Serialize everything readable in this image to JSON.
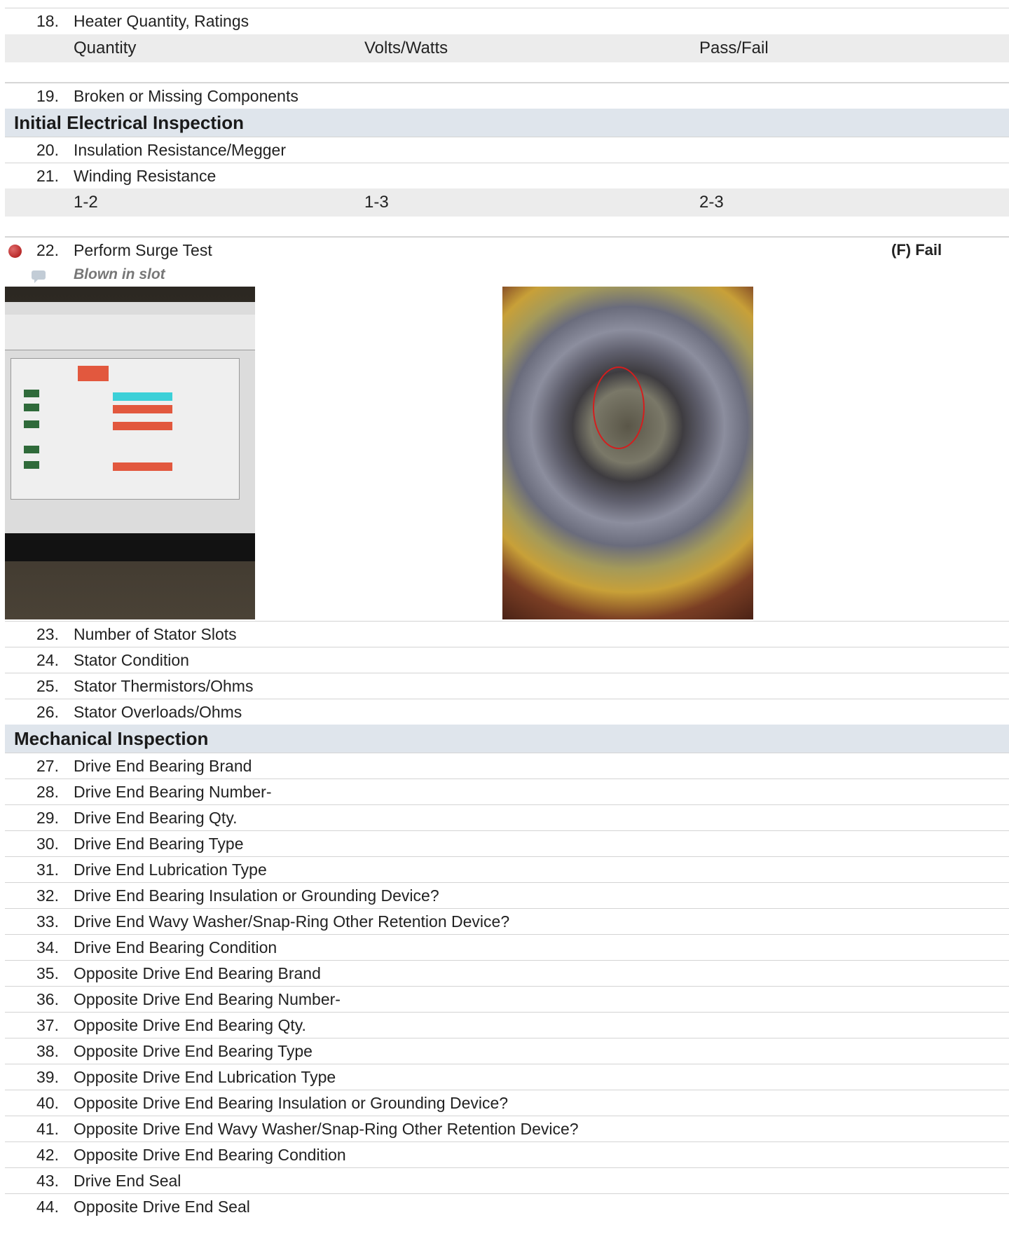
{
  "items_top": [
    {
      "num": "18.",
      "label": "Heater Quantity, Ratings"
    }
  ],
  "heater_columns": [
    "Quantity",
    "Volts/Watts",
    "Pass/Fail"
  ],
  "item_19": {
    "num": "19.",
    "label": "Broken or Missing Components"
  },
  "sections": {
    "initial_electrical": "Initial Electrical Inspection",
    "mechanical": "Mechanical Inspection"
  },
  "electrical_items": [
    {
      "num": "20.",
      "label": "Insulation Resistance/Megger"
    },
    {
      "num": "21.",
      "label": "Winding Resistance"
    }
  ],
  "winding_columns": [
    "1-2",
    "1-3",
    "2-3"
  ],
  "surge_test": {
    "num": "22.",
    "label": "Perform Surge Test",
    "result": "(F) Fail",
    "status_color": "#c0392b",
    "comment": "Blown in slot"
  },
  "stator_items": [
    {
      "num": "23.",
      "label": "Number of Stator Slots"
    },
    {
      "num": "24.",
      "label": "Stator Condition"
    },
    {
      "num": "25.",
      "label": "Stator Thermistors/Ohms"
    },
    {
      "num": "26.",
      "label": "Stator Overloads/Ohms"
    }
  ],
  "mechanical_items": [
    {
      "num": "27.",
      "label": "Drive End Bearing Brand"
    },
    {
      "num": "28.",
      "label": "Drive End Bearing Number-"
    },
    {
      "num": "29.",
      "label": "Drive End Bearing Qty."
    },
    {
      "num": "30.",
      "label": "Drive End Bearing Type"
    },
    {
      "num": "31.",
      "label": "Drive End Lubrication Type"
    },
    {
      "num": "32.",
      "label": "Drive End Bearing Insulation or Grounding Device?"
    },
    {
      "num": "33.",
      "label": "Drive End Wavy Washer/Snap-Ring Other Retention Device?"
    },
    {
      "num": "34.",
      "label": "Drive End Bearing Condition"
    },
    {
      "num": "35.",
      "label": "Opposite Drive End Bearing Brand"
    },
    {
      "num": "36.",
      "label": "Opposite Drive End Bearing Number-"
    },
    {
      "num": "37.",
      "label": "Opposite Drive End Bearing Qty."
    },
    {
      "num": "38.",
      "label": "Opposite Drive End Bearing Type"
    },
    {
      "num": "39.",
      "label": "Opposite Drive End Lubrication Type"
    },
    {
      "num": "40.",
      "label": "Opposite Drive End Bearing Insulation or Grounding Device?"
    },
    {
      "num": "41.",
      "label": "Opposite Drive End Wavy Washer/Snap-Ring Other Retention Device?"
    },
    {
      "num": "42.",
      "label": "Opposite Drive End Bearing Condition"
    },
    {
      "num": "43.",
      "label": "Drive End Seal"
    },
    {
      "num": "44.",
      "label": "Opposite Drive End Seal"
    }
  ],
  "colors": {
    "section_bg": "#dfe5ec",
    "subhead_bg": "#ececec",
    "fail_dot": "#c0392b"
  }
}
